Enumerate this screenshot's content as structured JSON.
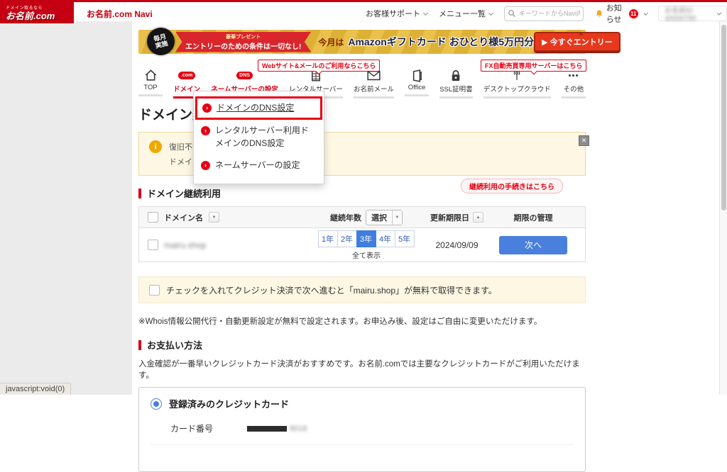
{
  "header": {
    "logo_tagline": "ドメイン取るなら",
    "logo_brand": "お名前.com",
    "navi_title": "お名前.com Navi",
    "support_label": "お客様サポート",
    "menu_label": "メニュー一覧",
    "search_placeholder": "キーワードからNavi内を検索",
    "notice_label": "お知らせ",
    "notice_count": "11",
    "account_masked": "お名前ID 40000780"
  },
  "banner": {
    "badge_top": "毎月",
    "badge_bottom": "実施",
    "ribbon_small": "豪華プレゼント",
    "ribbon_main": "エントリーのための条件は一切なし!",
    "lead": "今月は",
    "headline": "Amazonギフトカード おひとり様5万円分",
    "cta_label": "▶ 今すぐエントリー",
    "close_label": "✕"
  },
  "nav": {
    "tooltip_web": "Webサイト&メールのご利用ならこちら",
    "tooltip_fx": "FX自動売買専用サーバーはこちら",
    "tabs": [
      {
        "label": "TOP",
        "icon": "home-icon",
        "active": false
      },
      {
        "label": "ドメイン",
        "icon": "domain-com-icon",
        "active": true,
        "icon_text": ".com"
      },
      {
        "label": "ネームサーバーの設定",
        "icon": "dns-icon",
        "active": true,
        "icon_text": "DNS"
      },
      {
        "label": "レンタルサーバー",
        "icon": "rental-server-icon",
        "active": false
      },
      {
        "label": "お名前メール",
        "icon": "mail-icon",
        "active": false
      },
      {
        "label": "Office",
        "icon": "office-icon",
        "active": false
      },
      {
        "label": "SSL証明書",
        "icon": "ssl-lock-icon",
        "active": false
      },
      {
        "label": "デスクトップクラウド",
        "icon": "desktop-cloud-icon",
        "active": false
      },
      {
        "label": "その他",
        "icon": "more-icon",
        "active": false
      }
    ]
  },
  "dropdown": {
    "items": [
      "ドメインのDNS設定",
      "レンタルサーバー利用ドメインのDNS設定",
      "ネームサーバーの設定"
    ]
  },
  "page": {
    "title": "ドメイン契約更新"
  },
  "info_box": {
    "line1": "復旧不能とな",
    "line2": "ドメインの復",
    "close_label": "✕"
  },
  "renewal": {
    "section_title": "ドメイン継続利用",
    "procedure_pill": "継続利用の手続きはこちら",
    "columns": {
      "domain": "ドメイン名",
      "years": "継続年数",
      "years_select": "選択",
      "deadline": "更新期限日",
      "management": "期限の管理"
    },
    "row": {
      "domain_masked": "mairu.shop",
      "years": [
        "1年",
        "2年",
        "3年",
        "4年",
        "5年"
      ],
      "selected_year": "3年",
      "show_all": "全て表示",
      "deadline": "2024/09/09",
      "next_label": "次へ"
    }
  },
  "promo_note": {
    "text": "チェックを入れてクレジット決済で次へ進むと「mairu.shop」が無料で取得できます。"
  },
  "whois_note": "※Whois情報公開代行・自動更新設定が無料で設定されます。お申込み後、設定はご自由に変更いただけます。",
  "payment": {
    "section_title": "お支払い方法",
    "description": "入金確認が一番早いクレジットカード決済がおすすめです。お名前.comでは主要なクレジットカードがご利用いただけます。",
    "registered_card_label": "登録済みのクレジットカード",
    "card_number_label": "カード番号",
    "card_digits_masked": "8018"
  },
  "statusbar": {
    "link_preview": "javascript:void(0)"
  },
  "colors": {
    "brand_red": "#c40012",
    "accent_red": "#e60012",
    "active_blue": "#4a80dd",
    "banner_gold": "#e3b93f",
    "info_bg": "#fdf7e4"
  }
}
